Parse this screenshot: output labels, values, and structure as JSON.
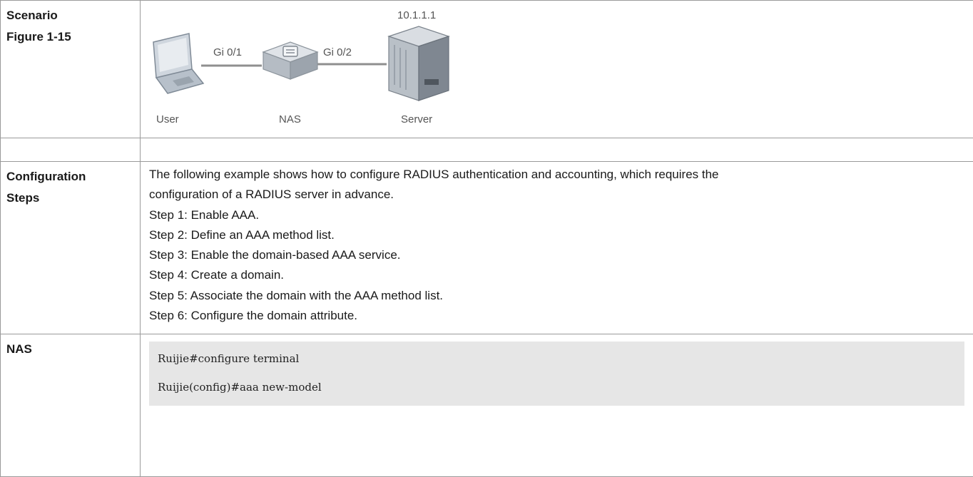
{
  "scenario": {
    "label_line1": "Scenario",
    "label_line2": "Figure 1-15",
    "diagram": {
      "ip_label": "10.1.1.1",
      "port_left": "Gi 0/1",
      "port_right": "Gi 0/2",
      "device_user": "User",
      "device_nas": "NAS",
      "device_server": "Server"
    }
  },
  "config_steps": {
    "label_line1": "Configuration",
    "label_line2": "Steps",
    "intro_line1": "The following example shows how to configure RADIUS authentication and accounting, which requires the",
    "intro_line2": "configuration of a RADIUS server in advance.",
    "steps": [
      "Step 1: Enable AAA.",
      "Step 2: Define an AAA method list.",
      "Step 3: Enable the domain-based AAA service.",
      "Step 4: Create a domain.",
      "Step 5: Associate the domain with the AAA method list.",
      "Step 6: Configure the domain attribute."
    ]
  },
  "nas": {
    "label": "NAS",
    "code_lines": [
      "Ruijie#configure terminal",
      "Ruijie(config)#aaa new-model"
    ]
  },
  "icons": [
    "laptop-icon",
    "switch-icon",
    "server-icon"
  ]
}
